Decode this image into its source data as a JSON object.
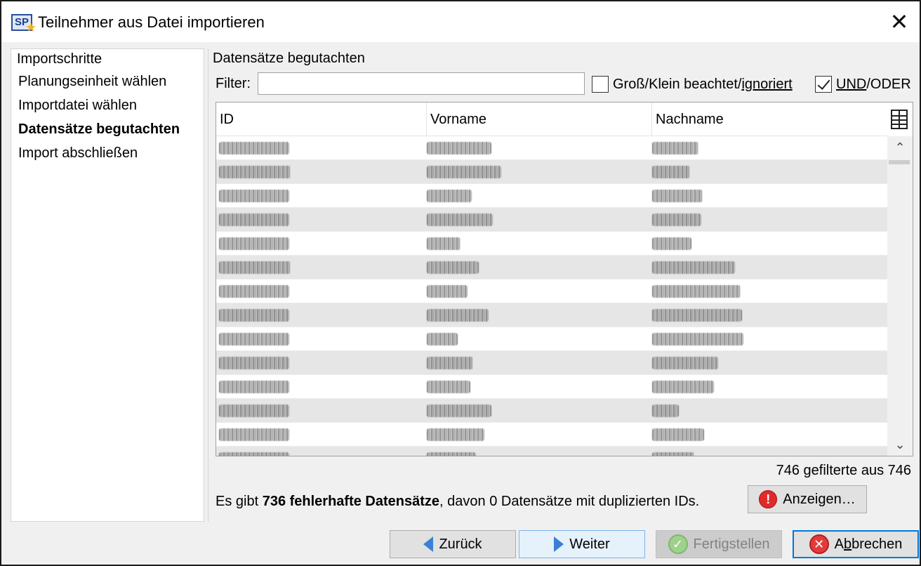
{
  "window": {
    "title": "Teilnehmer aus Datei importieren",
    "app_icon_text": "SP",
    "close_glyph": "✕"
  },
  "sidebar": {
    "title": "Importschritte",
    "steps": [
      {
        "label": "Planungseinheit wählen",
        "active": false
      },
      {
        "label": "Importdatei wählen",
        "active": false
      },
      {
        "label": "Datensätze begutachten",
        "active": true
      },
      {
        "label": "Import abschließen",
        "active": false
      }
    ]
  },
  "main": {
    "section_title": "Datensätze begutachten",
    "filter_label": "Filter:",
    "filter_value": "",
    "case_checkbox": {
      "prefix": "Groß/Klein beachtet/",
      "underlined": "ignoriert",
      "checked": false
    },
    "andor_checkbox": {
      "underlined": "UND",
      "suffix": "/ODER",
      "checked": true
    },
    "columns": [
      "ID",
      "Vorname",
      "Nachname"
    ],
    "column_toggle_icon": "table-columns-icon",
    "scroll_up_glyph": "⌃",
    "scroll_down_glyph": "⌄",
    "row_count": 14,
    "count_text": "746 gefilterte aus 746",
    "error_prefix": "Es gibt ",
    "error_bold": "736 fehlerhafte Datensätze",
    "error_suffix": ", davon 0 Datensätze mit duplizierten IDs.",
    "show_button": "Anzeigen…",
    "show_icon_glyph": "!"
  },
  "footer": {
    "back_label": "Zurück",
    "next_label": "Weiter",
    "finish_label": "Fertigstellen",
    "cancel_prefix": "A",
    "cancel_underlined": "b",
    "cancel_suffix": "brechen",
    "finish_icon_glyph": "✓",
    "cancel_icon_glyph": "✕"
  },
  "colors": {
    "accent": "#0078d7",
    "row_alt": "#e6e6e6",
    "error_red": "#e02b2b",
    "arrow_blue": "#3a80d6"
  }
}
